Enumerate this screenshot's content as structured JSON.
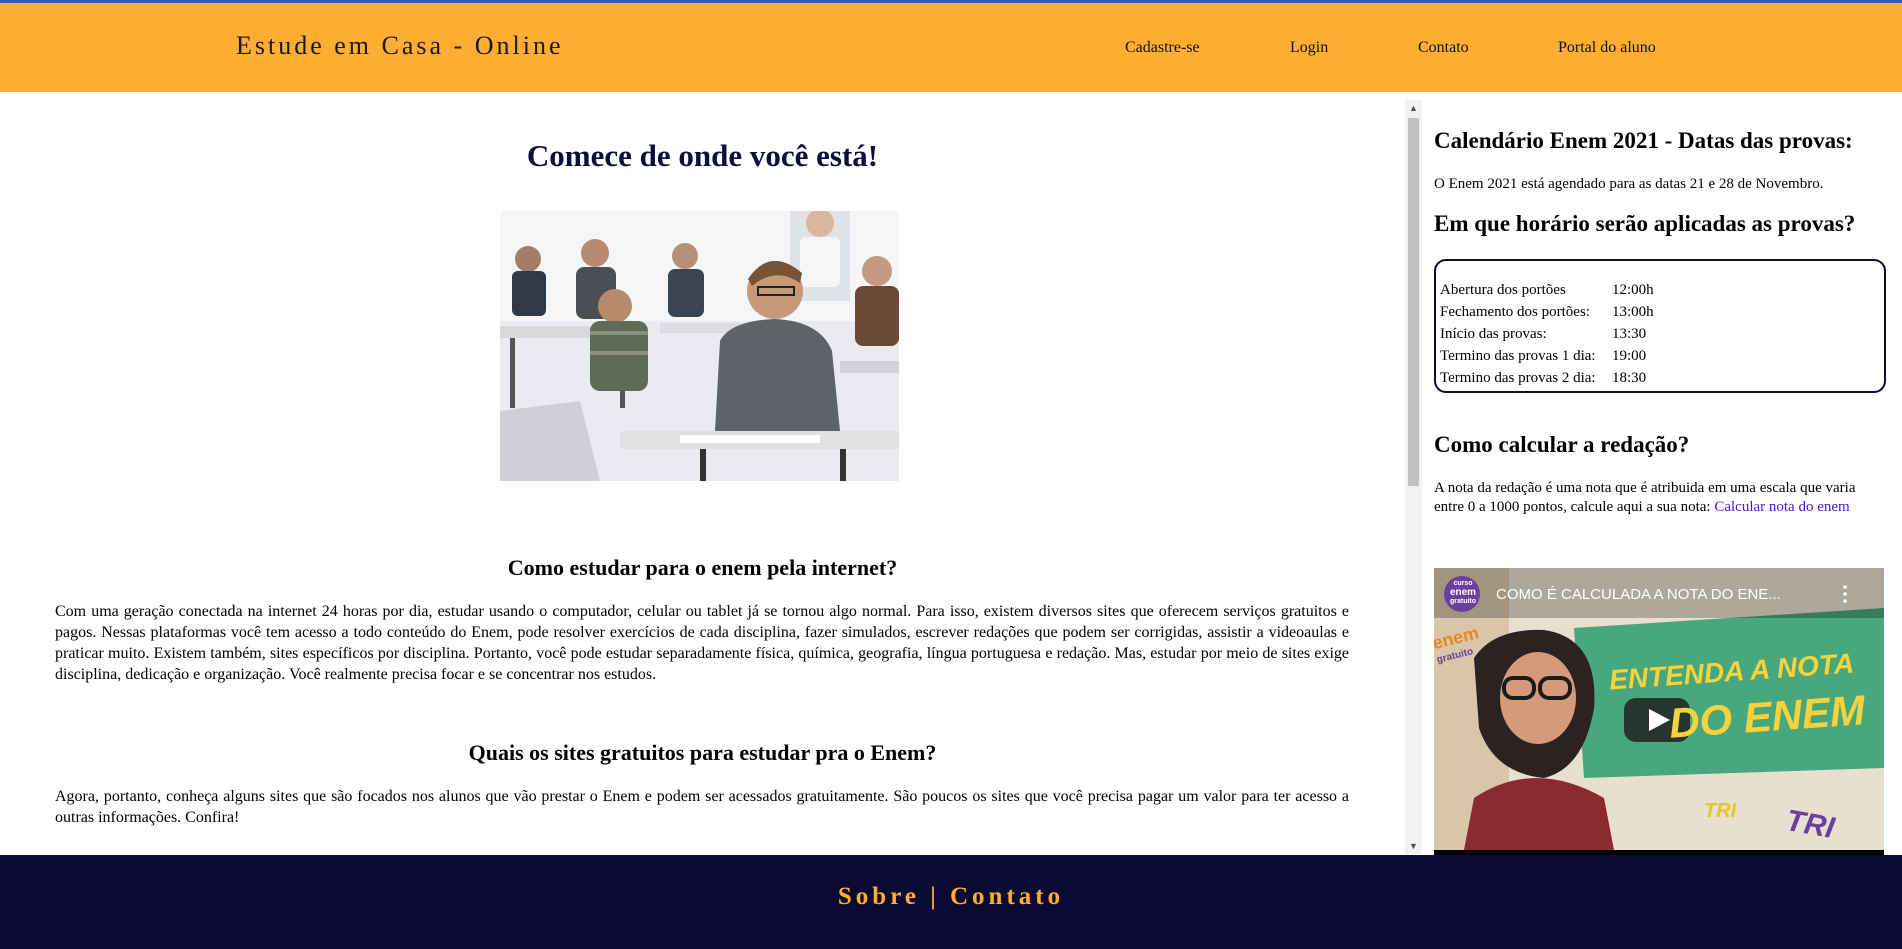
{
  "header": {
    "brand": "Estude em Casa - Online",
    "nav": [
      "Cadastre-se",
      "Login",
      "Contato",
      "Portal do aluno"
    ]
  },
  "main": {
    "hero_title": "Comece de onde você está!",
    "section1_title": "Como estudar para o enem pela internet?",
    "section1_text": "Com uma geração conectada na internet 24 horas por dia, estudar usando o computador, celular ou tablet já se tornou algo normal. Para isso, existem diversos sites que oferecem serviços gratuitos e pagos. Nessas plataformas você tem acesso a todo conteúdo do Enem, pode resolver exercícios de cada disciplina, fazer simulados, escrever redações que podem ser corrigidas, assistir a videoaulas e praticar muito. Existem também, sites específicos por disciplina. Portanto, você pode estudar separadamente física, química, geografia, língua portuguesa e redação. Mas, estudar por meio de sites exige disciplina, dedicação e organização. Você realmente precisa focar e se concentrar nos estudos.",
    "section2_title": "Quais os sites gratuitos para estudar pra o Enem?",
    "section2_text": "Agora, portanto, conheça alguns sites que são focados nos alunos que vão prestar o Enem e podem ser acessados gratuitamente. São poucos os sites que você precisa pagar um valor para ter acesso a outras informações. Confira!"
  },
  "sidebar": {
    "calendar_title": "Calendário Enem 2021 - Datas das provas:",
    "calendar_text": "O Enem 2021 está agendado para as datas 21 e 28 de Novembro.",
    "schedule_title": "Em que horário serão aplicadas as provas?",
    "schedule": [
      {
        "label": "Abertura dos portões",
        "value": "12:00h"
      },
      {
        "label": "Fechamento dos portões:",
        "value": "13:00h"
      },
      {
        "label": "Início das provas:",
        "value": "13:30"
      },
      {
        "label": "Termino das provas 1 dia:",
        "value": "19:00"
      },
      {
        "label": "Termino das provas 2 dia:",
        "value": "18:30"
      }
    ],
    "essay_title": "Como calcular a redação?",
    "essay_text": "A nota da redação é uma nota que é atribuida em uma escala que varia entre 0 a 1000 pontos, calcule aqui a sua nota:",
    "essay_link": "Calcular nota do enem",
    "video": {
      "title": "COMO É CALCULADA A NOTA DO ENE...",
      "channel_badge_lines": [
        "curso",
        "enem",
        "gratuito"
      ],
      "thumb_text_line1": "ENTENDA A NOTA",
      "thumb_text_line2": "DO ENEM",
      "thumb_tag1": "TRI",
      "thumb_tag2": "TRI",
      "side_badge_line1": "enem",
      "side_badge_line2": "gratuito"
    }
  },
  "footer": {
    "about": "Sobre",
    "separator": "|",
    "contact": "Contato"
  },
  "colors": {
    "header_bg": "#ffad33",
    "footer_bg": "#0b0a33",
    "accent": "#ffad33",
    "link": "#4b17e0"
  }
}
